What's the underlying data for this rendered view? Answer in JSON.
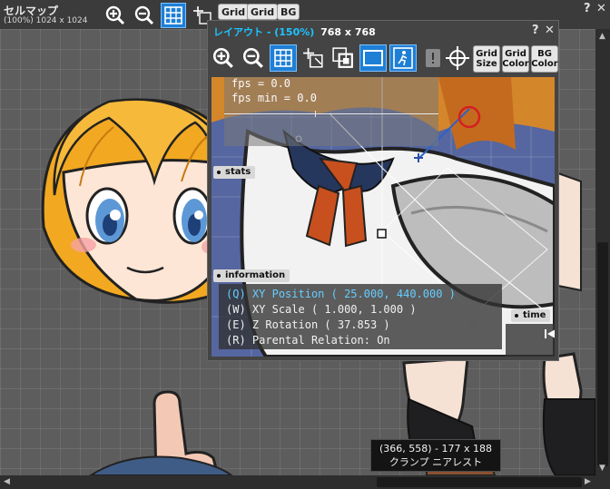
{
  "cellmap": {
    "title": "セルマップ",
    "subtitle": "(100%) 1024 x 1024",
    "buttons": {
      "grid_size": "Grid",
      "grid_color": "Grid",
      "bg": "BG"
    },
    "controls": {
      "help": "?",
      "close": "✕"
    }
  },
  "layout_window": {
    "title_prefix": "レイアウト - ",
    "zoom": "(150%)",
    "size": "768 x 768",
    "controls": {
      "help": "?",
      "close": "✕"
    },
    "text_buttons": {
      "grid_size": [
        "Grid",
        "Size"
      ],
      "grid_color": [
        "Grid",
        "Color"
      ],
      "bg_color": [
        "BG",
        "Color"
      ]
    },
    "stats": {
      "label": "stats",
      "lines": [
        "fps = 0.0",
        "fps min = 0.0"
      ]
    },
    "information": {
      "label": "information",
      "lines": [
        {
          "key": "(Q)",
          "text": "XY Position ( 25.000, 440.000 )"
        },
        {
          "key": "(W)",
          "text": "XY Scale ( 1.000, 1.000 )"
        },
        {
          "key": "(E)",
          "text": "Z Rotation ( 37.853 )"
        },
        {
          "key": "(R)",
          "text": "Parental Relation: On"
        }
      ]
    },
    "time": {
      "label": "time"
    }
  },
  "tooltip": {
    "line1": "(366, 558) - 177 x 188",
    "line2": "クランプ ニアレスト"
  },
  "colors": {
    "accent_blue": "#1e7fd6",
    "title_cyan": "#1cc4ff",
    "info_highlight": "#66ccff"
  }
}
